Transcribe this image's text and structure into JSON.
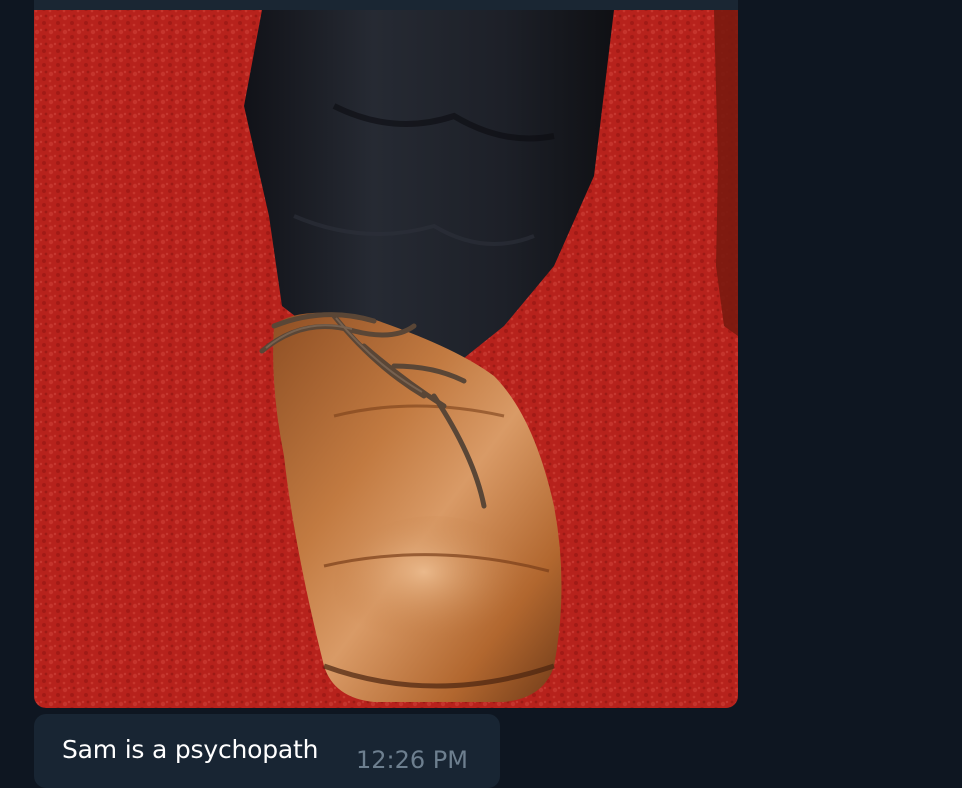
{
  "message": {
    "text": "Sam is a psychopath",
    "time": "12:26 PM"
  },
  "photo": {
    "subject": "brown leather shoe on red carpet",
    "colors": {
      "carpet": "#c0251f",
      "carpet_dark": "#8e1512",
      "trouser": "#1b1d24",
      "shoe": "#b46a35",
      "shoe_highlight": "#d99a66",
      "lace": "#5a4636"
    }
  },
  "theme": {
    "background": "#0e1621",
    "bubble": "#182533",
    "text": "#ffffff",
    "time_text": "#6d7f8f"
  }
}
